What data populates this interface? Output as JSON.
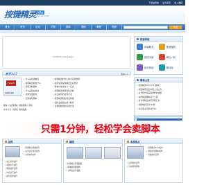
{
  "top": {
    "links": [
      "下载站导航",
      "设为首页",
      "加入收藏"
    ]
  },
  "header": {
    "logo": "按键精灵",
    "badge": "论坛",
    "subtitle": "ANJIAN.COM"
  },
  "nav": {
    "items": [
      "首页",
      "资讯",
      "论坛",
      "下载",
      "脚本",
      "源码",
      "教程",
      "视频",
      "用户中心",
      "充值"
    ]
  },
  "search": {
    "button": "搜索"
  },
  "main": {
    "plugins_text": "Couldn't load plugin."
  },
  "right": {
    "quick_title": "快速导航",
    "quick_items": [
      "按键精灵",
      "按键宝典",
      "操作手册",
      "每日一贴",
      "操作系统",
      "源码库"
    ],
    "notice_title": "最新公告",
    "notices": [
      "• 按键精灵8.20(8.1)发布了",
      "• 按键精灵论坛新版上线公告",
      "• 关于积分和等级调整的说明",
      "• 每周精选脚本第十二期",
      "• 新手帮助及常见问题汇总",
      "• 按键精灵官方QQ群",
      "• 论坛版主招募进行中"
    ]
  },
  "news": {
    "title": "新手入门",
    "more": "更多>>",
    "thumb_caption": "按键精灵教程",
    "thumb_flash": "FLASH",
    "list_a": [
      "• 什么是按键精灵",
      "• 按键精灵能做什么",
      "• 如何录制脚本",
      "• 什么是前台后台",
      "• 如何使用插件",
      "• 怎样编写脚本"
    ],
    "list_b": [
      "• 按键精灵制作小助手完整教程",
      "• 如何使用按键精灵自动登录",
      "• 脚本中常用命令一览表",
      "• 按键精灵找图找色详解",
      "• 后台操作的实现方法",
      "• 按键精灵网络验证教程",
      "• 如何生成独立的小精灵",
      "• 变量和数组的使用方法"
    ],
    "bottom": [
      "推荐 | 免费教程 | 视频教程 | 源码",
      "命令大全 | 插件 | 常用函数"
    ]
  },
  "ad": {
    "text_a": "只需",
    "text_b": "1分钟",
    "text_c": "，轻松学会",
    "text_d": "卖脚本"
  },
  "panels": [
    {
      "title": "插件",
      "items": [
        "• 按键精灵找图插件",
        "• 后台鼠标键盘插件",
        "• 文件操作插件",
        "• 窗口控制插件",
        "• 系统信息插件",
        "• 网络插件说明",
        "• 内存读写插件",
        "• 颜色处理插件"
      ]
    },
    {
      "title": "截图",
      "items": [
        "• 按键精灵界面截图",
        "• 脚本编辑器截图",
        "• 小精灵运行截图"
      ]
    },
    {
      "title": "本周热点",
      "items": [
        "• 按键精灵8.20发布",
        "• 网络游戏脚本制作",
        "• 找图找色实例",
        "• 后台脚本实例",
        "• 自动挂机脚本"
      ]
    }
  ]
}
